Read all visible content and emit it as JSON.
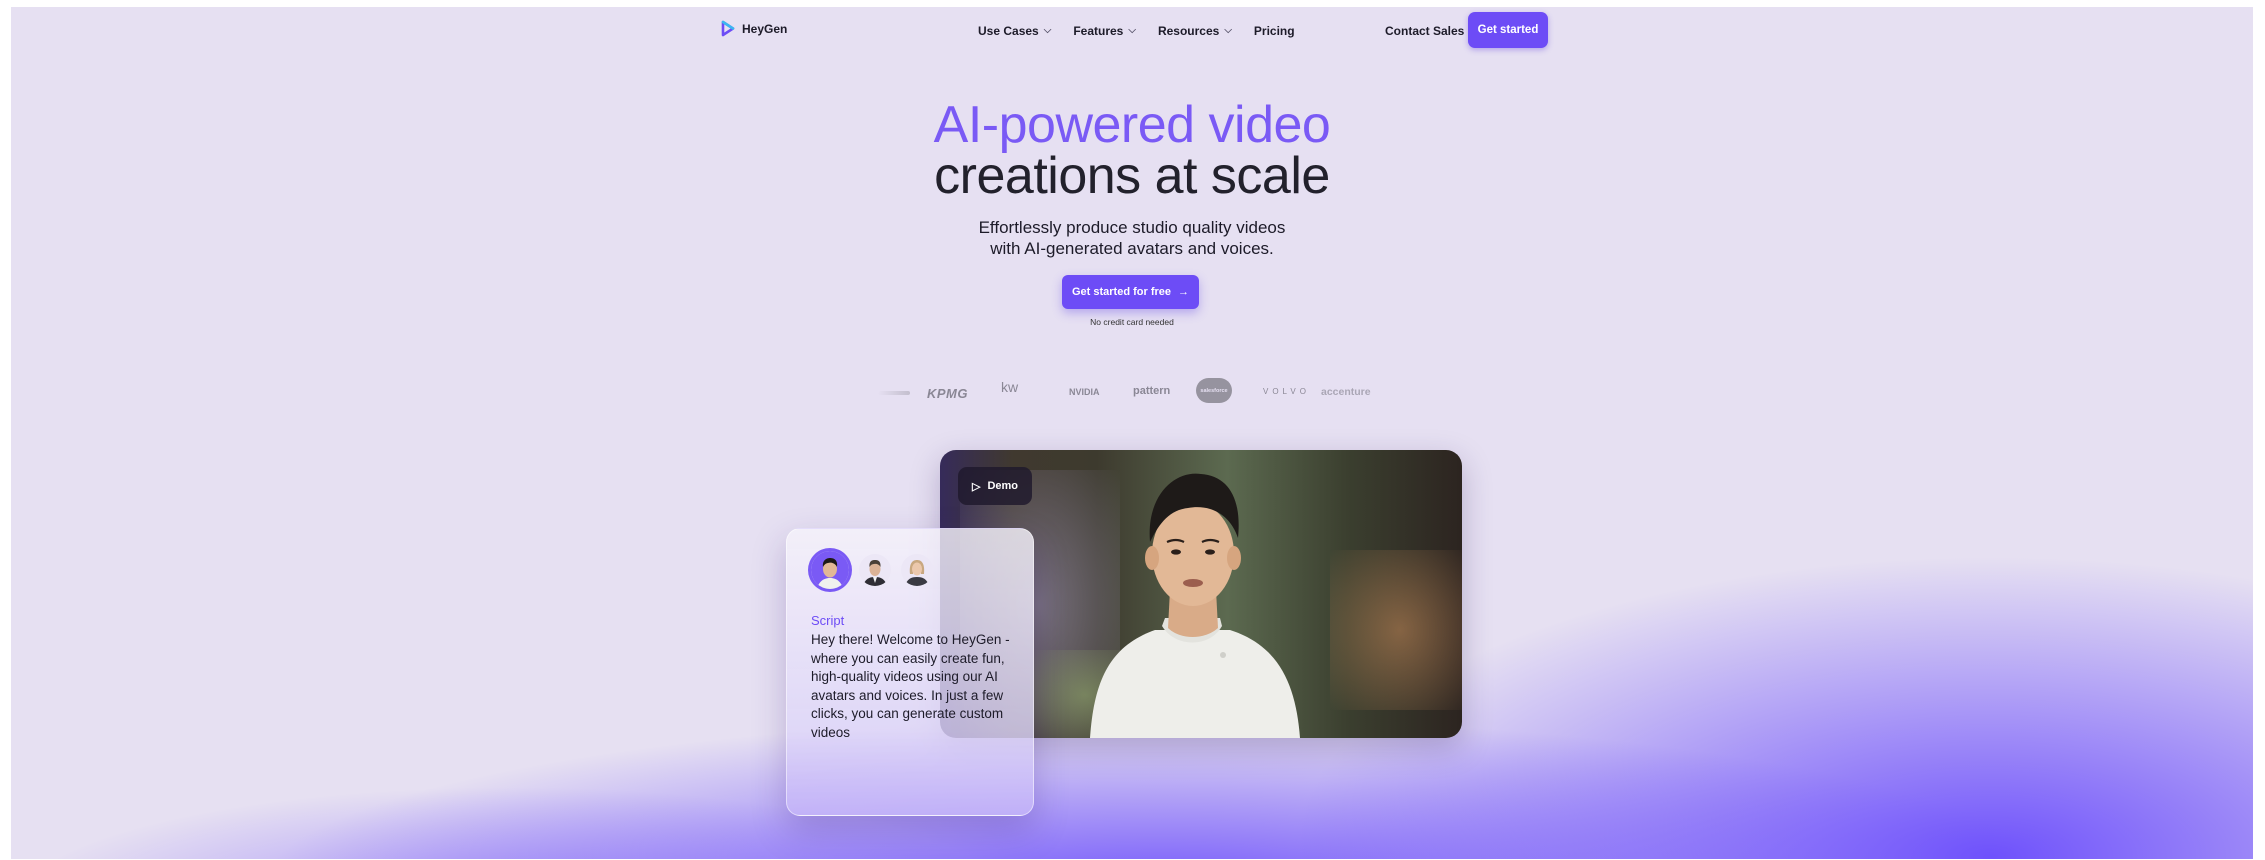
{
  "nav": {
    "logo_text": "HeyGen",
    "items": [
      {
        "label": "Use Cases",
        "has_dropdown": true
      },
      {
        "label": "Features",
        "has_dropdown": true
      },
      {
        "label": "Resources",
        "has_dropdown": true
      },
      {
        "label": "Pricing",
        "has_dropdown": false
      }
    ],
    "contact_label": "Contact Sales",
    "get_started_label": "Get started",
    "dropdown_glyph": "⌵"
  },
  "hero": {
    "title_line1": "AI-powered video",
    "title_line2": "creations at scale",
    "subtitle_line1": "Effortlessly produce studio quality videos",
    "subtitle_line2": "with AI-generated avatars and voices.",
    "cta_label": "Get started for free",
    "cta_arrow": "→",
    "cta_note": "No credit card needed"
  },
  "logos": [
    "KPMG",
    "kw",
    "NVIDIA",
    "pattern",
    "salesforce",
    "VOLVO",
    "accenture"
  ],
  "demo": {
    "label": "Demo",
    "play_glyph": "▷"
  },
  "script_card": {
    "label": "Script",
    "text": "Hey there! Welcome to HeyGen - where you can easily create fun, high-quality videos using our AI avatars and voices. In just a few clicks, you can generate custom videos"
  },
  "colors": {
    "accent": "#6d4cf6",
    "title_accent": "#7a5af5",
    "background": "#e6e0f2",
    "text": "#1d1b29"
  }
}
